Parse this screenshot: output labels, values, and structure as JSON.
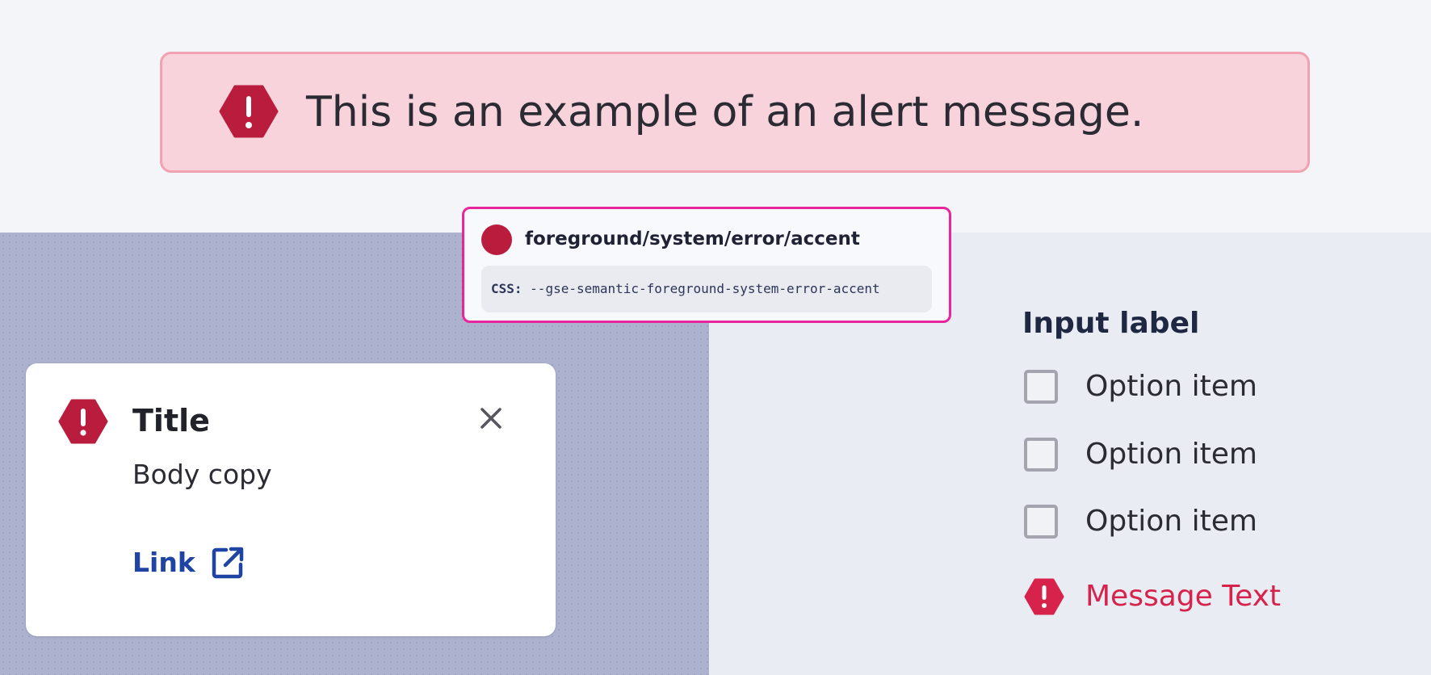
{
  "colors": {
    "error_accent": "#b91c3c",
    "error_text": "#d7234b",
    "alert_background": "#f8d3db",
    "alert_border": "#f0a1b2",
    "tooltip_border": "#e8259a",
    "link": "#1f44a3"
  },
  "alert_banner": {
    "icon": "error-hexagon-icon",
    "message": "This is an example of an alert message."
  },
  "token_tooltip": {
    "swatch_color": "#b91c3c",
    "token_name": "foreground/system/error/accent",
    "css_prefix": "CSS:",
    "css_variable": "--gse-semantic-foreground-system-error-accent"
  },
  "toast": {
    "icon": "error-hexagon-icon",
    "title": "Title",
    "body": "Body copy",
    "link_label": "Link",
    "link_icon": "external-link-icon",
    "close_icon": "close-icon"
  },
  "checkbox_group": {
    "label": "Input label",
    "options": [
      {
        "label": "Option item",
        "checked": false
      },
      {
        "label": "Option item",
        "checked": false
      },
      {
        "label": "Option item",
        "checked": false
      }
    ],
    "error_icon": "error-hexagon-icon",
    "error_message": "Message Text"
  }
}
